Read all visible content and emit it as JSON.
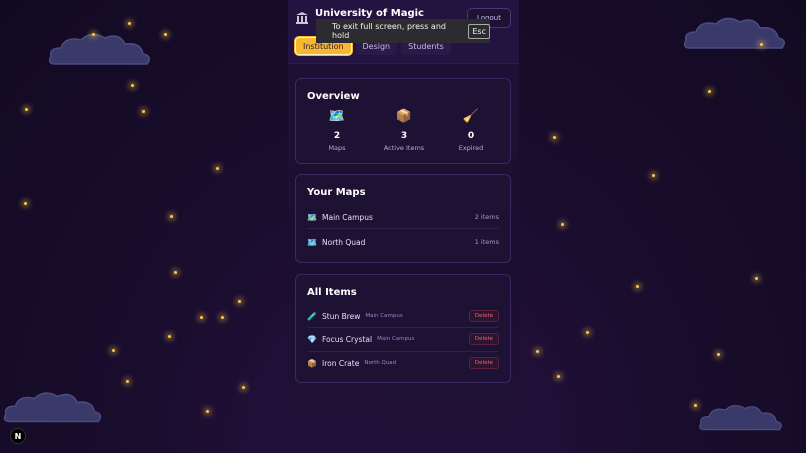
{
  "header": {
    "institution_name": "University of Magic",
    "logout_label": "Logout",
    "tabs": [
      {
        "label": "Institution",
        "active": true
      },
      {
        "label": "Design",
        "active": false
      },
      {
        "label": "Students",
        "active": false
      }
    ]
  },
  "toast": {
    "text": "To exit full screen, press and hold",
    "key": "Esc"
  },
  "overview": {
    "title": "Overview",
    "stats": [
      {
        "icon": "map-icon",
        "value": "2",
        "label": "Maps"
      },
      {
        "icon": "box-icon",
        "value": "3",
        "label": "Active Items"
      },
      {
        "icon": "broom-icon",
        "value": "0",
        "label": "Expired"
      }
    ]
  },
  "maps": {
    "title": "Your Maps",
    "items": [
      {
        "name": "Main Campus",
        "count": "2 items"
      },
      {
        "name": "North Quad",
        "count": "1 items"
      }
    ]
  },
  "items": {
    "title": "All Items",
    "delete_label": "Delete",
    "list": [
      {
        "icon": "potion-icon",
        "name": "Stun Brew",
        "map": "Main Campus"
      },
      {
        "icon": "gem-icon",
        "name": "Focus Crystal",
        "map": "Main Campus"
      },
      {
        "icon": "crate-icon",
        "name": "Iron Crate",
        "map": "North Quad"
      }
    ]
  },
  "colors": {
    "accent": "#f5b82e",
    "background": "#1a0d2e",
    "danger": "#f0607a"
  }
}
